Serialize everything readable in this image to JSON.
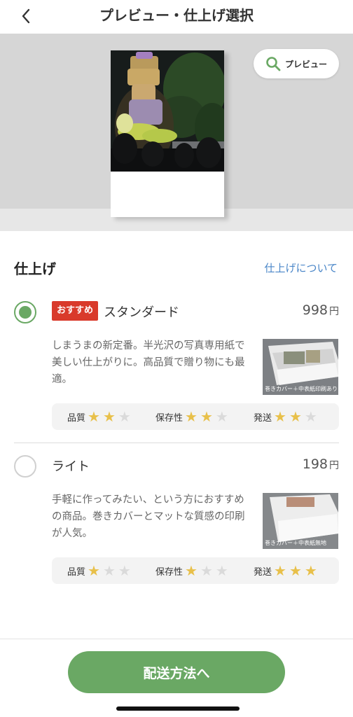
{
  "nav": {
    "title": "プレビュー・仕上げ選択"
  },
  "preview": {
    "button_label": "プレビュー"
  },
  "finish": {
    "section_title": "仕上げ",
    "about_link": "仕上げについて"
  },
  "options": [
    {
      "selected": true,
      "badge": "おすすめ",
      "name": "スタンダード",
      "price": "998",
      "currency": "円",
      "description": "しまうまの新定番。半光沢の写真専用紙で美しい仕上がりに。高品質で贈り物にも最適。",
      "thumb_caption": "巻きカバー＋中表紙印刷あり",
      "ratings": [
        {
          "label": "品質",
          "stars": 2,
          "max": 3
        },
        {
          "label": "保存性",
          "stars": 2,
          "max": 3
        },
        {
          "label": "発送",
          "stars": 2,
          "max": 3
        }
      ]
    },
    {
      "selected": false,
      "name": "ライト",
      "price": "198",
      "currency": "円",
      "description": "手軽に作ってみたい、という方におすすめの商品。巻きカバーとマットな質感の印刷が人気。",
      "thumb_caption": "巻きカバー＋中表紙無地",
      "ratings": [
        {
          "label": "品質",
          "stars": 1,
          "max": 3
        },
        {
          "label": "保存性",
          "stars": 1,
          "max": 3
        },
        {
          "label": "発送",
          "stars": 3,
          "max": 3
        }
      ]
    }
  ],
  "footer": {
    "cta_label": "配送方法へ"
  },
  "colors": {
    "accent_green": "#6aa864",
    "badge_red": "#d93a2b",
    "link_blue": "#4a86c8",
    "star_gold": "#e8c04a"
  }
}
